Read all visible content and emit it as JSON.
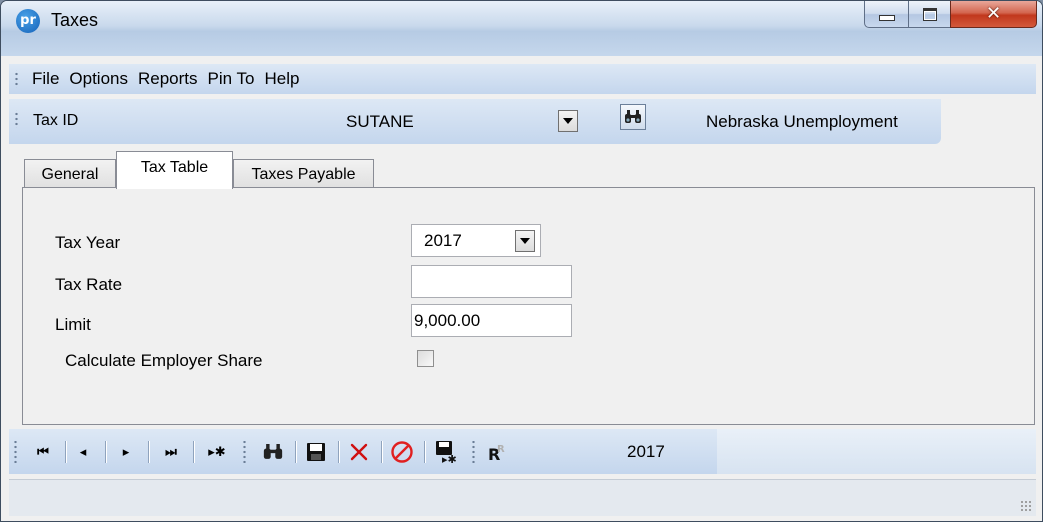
{
  "window": {
    "title": "Taxes",
    "app_icon_text": "pr"
  },
  "menu": {
    "items": [
      {
        "label": "File"
      },
      {
        "label": "Options"
      },
      {
        "label": "Reports"
      },
      {
        "label": "Pin To"
      },
      {
        "label": "Help"
      }
    ]
  },
  "taxid_bar": {
    "label": "Tax ID",
    "value": "SUTANE",
    "description": "Nebraska Unemployment"
  },
  "tabs": [
    {
      "label": "General",
      "selected": false
    },
    {
      "label": "Tax Table",
      "selected": true
    },
    {
      "label": "Taxes Payable",
      "selected": false
    }
  ],
  "form": {
    "tax_year": {
      "label": "Tax Year",
      "value": "2017"
    },
    "tax_rate": {
      "label": "Tax Rate",
      "value": ""
    },
    "limit": {
      "label": "Limit",
      "value": "9,000.00"
    },
    "employer_share": {
      "label": "Calculate Employer Share",
      "checked": false
    }
  },
  "navbar": {
    "year": "2017",
    "icons": [
      "first-record-icon",
      "previous-record-icon",
      "next-record-icon",
      "last-record-icon",
      "new-record-icon",
      "find-icon",
      "save-icon",
      "delete-icon",
      "cancel-icon",
      "save-new-icon",
      "report-icon"
    ]
  },
  "colors": {
    "toolbar": "#c4d6ed",
    "delete_red": "#d01010",
    "cancel_red": "#e02020",
    "close_button": "#c1381d"
  }
}
